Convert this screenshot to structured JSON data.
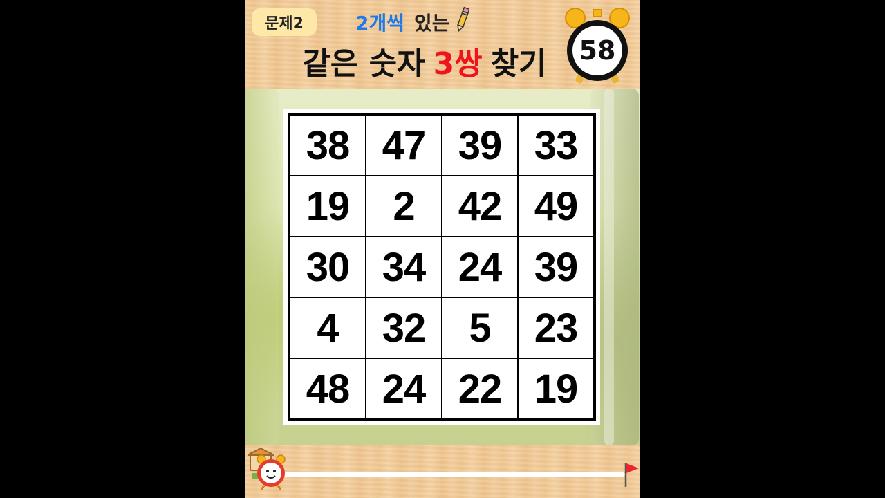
{
  "header": {
    "badge": "문제2",
    "subtitle_accent": "2개씩",
    "subtitle_rest": "있는",
    "title_part1": "같은 숫자",
    "title_accent": "3쌍",
    "title_part2": "찾기"
  },
  "timer": {
    "value": "58"
  },
  "grid": {
    "rows": [
      [
        "38",
        "47",
        "39",
        "33"
      ],
      [
        "19",
        "2",
        "42",
        "49"
      ],
      [
        "30",
        "34",
        "24",
        "39"
      ],
      [
        "4",
        "32",
        "5",
        "23"
      ],
      [
        "48",
        "24",
        "22",
        "19"
      ]
    ]
  },
  "progress": {
    "value": 0.0
  },
  "colors": {
    "accent_blue": "#1f7ae8",
    "accent_red": "#f0131c",
    "wood": "#f3cfa0"
  },
  "icons": [
    "pencil-icon",
    "alarm-clock-icon",
    "clock-character-icon",
    "finish-flag-icon"
  ]
}
